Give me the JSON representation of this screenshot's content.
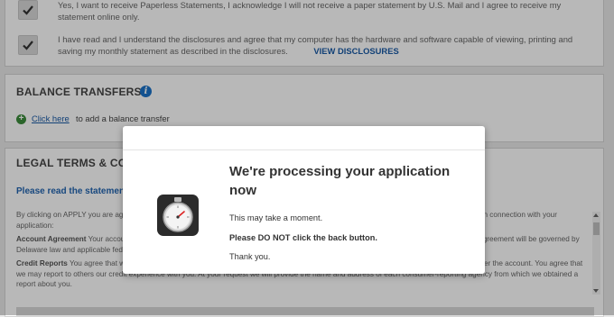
{
  "consent": {
    "paperless_text": "Yes, I want to receive Paperless Statements, I acknowledge I will not receive a paper statement by U.S. Mail and I agree to receive my statement online only.",
    "disclosures_text": "I have read and I understand the disclosures and agree that my computer has the hardware and software capable of viewing, printing and saving my monthly statement as described in the disclosures.",
    "view_disclosures_link": "VIEW DISCLOSURES"
  },
  "balance_transfers": {
    "title": "BALANCE TRANSFERS",
    "info_icon": "i",
    "click_here": "Click here",
    "add_text": "to add a balance transfer"
  },
  "legal": {
    "title": "LEGAL TERMS & CONDITIONS",
    "intro": "Please read the statements below carefully before filling out the application.",
    "para1": "By clicking on APPLY you are agreeing to the following. This application will be processed in Wilmington, Delaware. You agree to the following in connection with your application:",
    "agreement_label": "Account Agreement",
    "agreement_text": "Your account will be governed by the Cardmember Agreement that will be sent to you. You agree that the Cardmember Agreement will be governed by Delaware law and applicable federal law. Terms are subject to change in accordance with the Cardmember Agreement.",
    "credit_label": "Credit Reports",
    "credit_text": "You agree that we may obtain credit reports about you to evaluate your application and, if we issue you an account, to administer the account. You agree that we may report to others our credit experience with you. At your request we will provide the name and address of each consumer-reporting agency from which we obtained a report about you."
  },
  "modal": {
    "title": "We're processing your application now",
    "line1": "This may take a moment.",
    "line2": "Please DO NOT click the back button.",
    "line3": "Thank you.",
    "icon": "stopwatch-icon"
  },
  "colors": {
    "link": "#1a5aa6",
    "info_blue": "#1b72c8",
    "plus_green": "#3c8d3c"
  }
}
